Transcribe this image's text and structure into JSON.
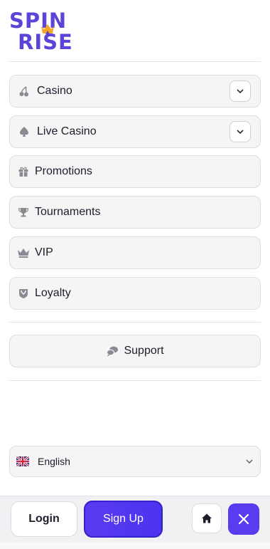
{
  "logo": {
    "line1": "SPIN",
    "line2": "RISE"
  },
  "menu": {
    "items": [
      {
        "label": "Casino",
        "icon": "cherries-icon",
        "expandable": true
      },
      {
        "label": "Live Casino",
        "icon": "spade-icon",
        "expandable": true
      },
      {
        "label": "Promotions",
        "icon": "gift-icon",
        "expandable": false
      },
      {
        "label": "Tournaments",
        "icon": "trophy-icon",
        "expandable": false
      },
      {
        "label": "VIP",
        "icon": "crown-icon",
        "expandable": false
      },
      {
        "label": "Loyalty",
        "icon": "shield-badge-icon",
        "expandable": false
      }
    ]
  },
  "support": {
    "label": "Support",
    "icon": "chat-bubbles-icon"
  },
  "language": {
    "selected": "English",
    "icon": "uk-flag-icon"
  },
  "bottom_bar": {
    "login_label": "Login",
    "signup_label": "Sign Up",
    "home_icon": "home-icon",
    "close_icon": "close-icon"
  },
  "colors": {
    "brand": "#5b45d9",
    "accent": "#5a3bf0",
    "item_bg": "#f5f5f6",
    "icon_gray": "#8a8a93"
  }
}
